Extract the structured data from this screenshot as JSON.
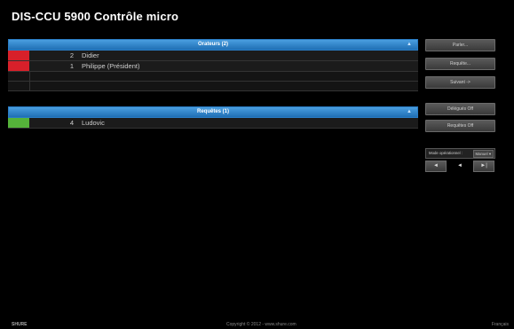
{
  "app": {
    "title": "DIS-CCU 5900 Contrôle micro"
  },
  "speakers": {
    "header": "Orateurs (2)",
    "rows": [
      {
        "num": "2",
        "name": "Didier",
        "color": "#d8202a"
      },
      {
        "num": "1",
        "name": "Philippe (Président)",
        "color": "#d8202a"
      }
    ]
  },
  "requests": {
    "header": "Requêtes (1)",
    "rows": [
      {
        "num": "4",
        "name": "Ludovic",
        "color": "#55b23a"
      }
    ]
  },
  "sidebar": {
    "speak": "Parler...",
    "request": "Requête...",
    "next": "Suivant ->",
    "delegates_off": "Délégués Off",
    "requests_off": "Requêtes Off",
    "mode_label": "Mode opérationnel :",
    "mode_value": "Manuel",
    "nav_first": "◄",
    "nav_prev": "◄",
    "nav_last": "►|"
  },
  "footer": {
    "brand": "SHURE",
    "copyright": "Copyright © 2012 - www.shure.com",
    "right": "Français"
  },
  "icons": {
    "collapse": "triangle-up-icon"
  }
}
